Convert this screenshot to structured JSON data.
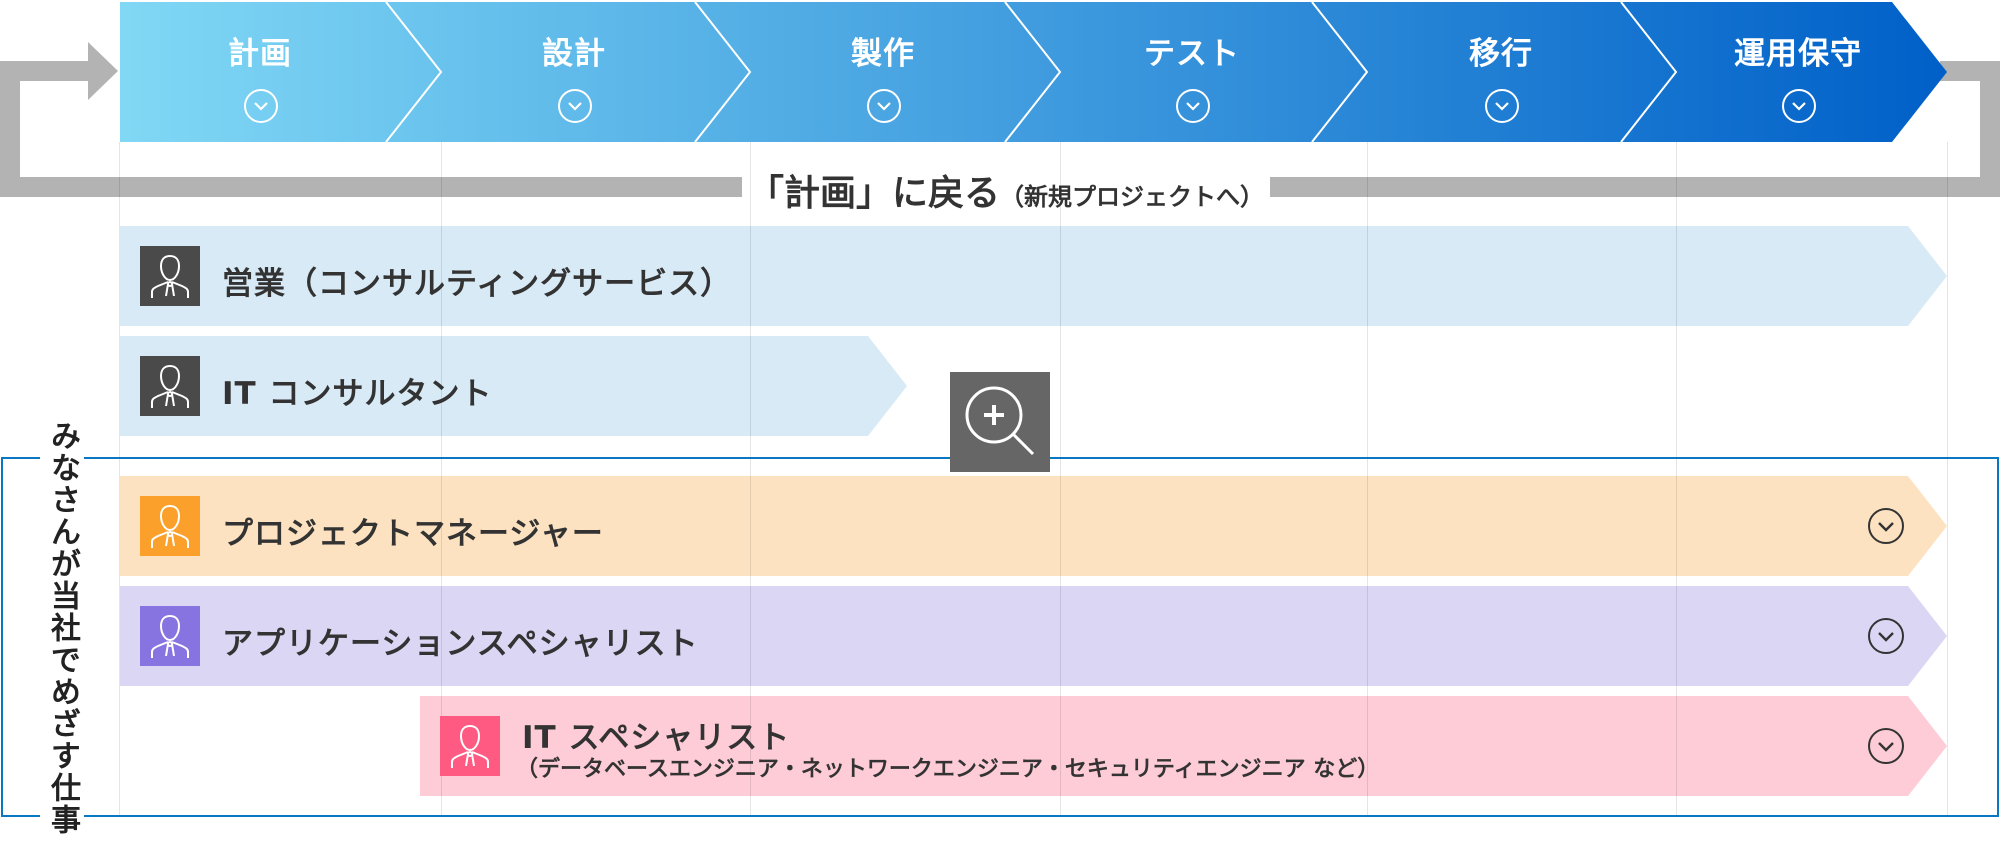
{
  "phases": [
    {
      "label": "計画",
      "icon": "chevron-down-circle-icon"
    },
    {
      "label": "設計",
      "icon": "chevron-down-circle-icon"
    },
    {
      "label": "製作",
      "icon": "chevron-down-circle-icon"
    },
    {
      "label": "テスト",
      "icon": "chevron-down-circle-icon"
    },
    {
      "label": "移行",
      "icon": "chevron-down-circle-icon"
    },
    {
      "label": "運用保守",
      "icon": "chevron-down-circle-icon"
    }
  ],
  "phase_gradient": {
    "start": "#80D8F5",
    "end": "#0060C8"
  },
  "loop": {
    "main": "「計画」に戻る",
    "sub": "（新規プロジェクトへ）",
    "color": "#B3B3B3"
  },
  "side_label": "みなさんが当社でめざす仕事",
  "highlight_border_color": "#0A77C2",
  "roles": [
    {
      "label": "営業（コンサルティングサービス）",
      "band_color": "#D8EAF6",
      "icon_color": "#4A4A4A",
      "expandable": false
    },
    {
      "label": "IT コンサルタント",
      "band_color": "#D8EAF6",
      "icon_color": "#4A4A4A",
      "expandable": false
    },
    {
      "label": "プロジェクトマネージャー",
      "band_color": "#FDE2C1",
      "icon_color": "#FBA02B",
      "expandable": true
    },
    {
      "label": "アプリケーションスペシャリスト",
      "band_color": "#DCD6F5",
      "icon_color": "#8874E0",
      "expandable": true
    },
    {
      "label": "IT スペシャリスト",
      "sub": "（データベースエンジニア・ネットワークエンジニア・セキュリティエンジニア など）",
      "band_color": "#FDCCD7",
      "icon_color": "#FF5B82",
      "expandable": true
    }
  ],
  "zoom_button": {
    "icon": "zoom-in-icon",
    "bg": "#666666"
  }
}
